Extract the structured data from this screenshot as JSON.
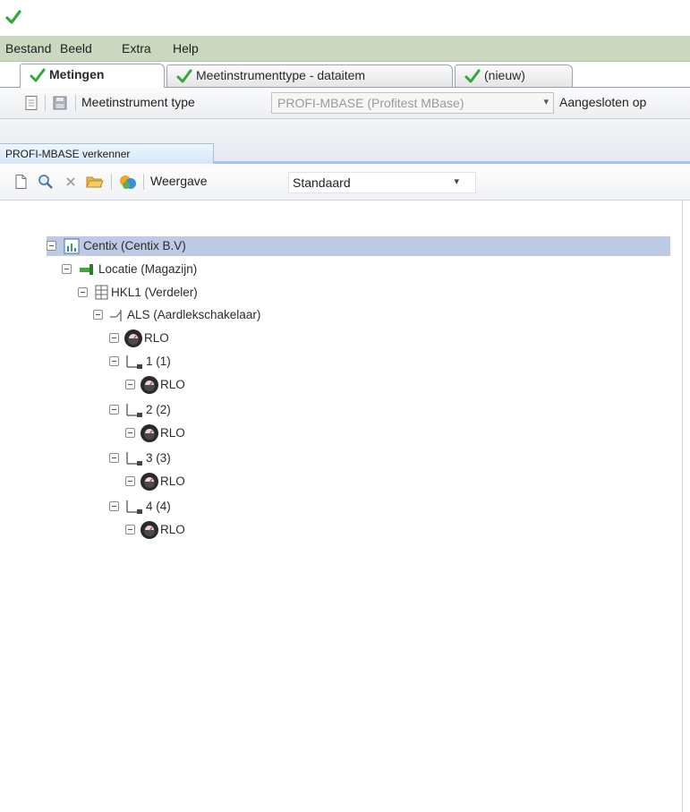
{
  "menu": {
    "items": [
      "Bestand",
      "Beeld",
      "Extra",
      "Help"
    ]
  },
  "tabs": [
    {
      "label": "Metingen",
      "active": true
    },
    {
      "label": "Meetinstrumenttype - dataitem",
      "active": false
    },
    {
      "label": "(nieuw)",
      "active": false
    }
  ],
  "toolbar1": {
    "type_label": "Meetinstrument type",
    "type_value": "PROFI-MBASE (Profitest MBase)",
    "connected_label": "Aangesloten op"
  },
  "panel": {
    "tab_label": "PROFI-MBASE verkenner"
  },
  "toolbar2": {
    "view_label": "Weergave",
    "view_value": "Standaard"
  },
  "tree": {
    "nodes": [
      {
        "text": "Centix (Centix B.V)",
        "selected": true
      },
      {
        "text": "Locatie (Magazijn)"
      },
      {
        "text": "HKL1 (Verdeler)"
      },
      {
        "text": "ALS (Aardlekschakelaar)"
      },
      {
        "text": "RLO"
      },
      {
        "text": "1 (1)"
      },
      {
        "text": "RLO"
      },
      {
        "text": "2 (2)"
      },
      {
        "text": "RLO"
      },
      {
        "text": "3 (3)"
      },
      {
        "text": "RLO"
      },
      {
        "text": "4 (4)"
      },
      {
        "text": "RLO"
      }
    ]
  },
  "colors": {
    "menubar": "#ccd7c0",
    "check_green": "#2fa83c",
    "selection": "#bccae4",
    "panel_tab": "#d4e7f8"
  },
  "icons": {
    "app": "green-check-icon",
    "company": "company-icon",
    "location": "green-flag-icon",
    "distributor": "distribution-board-icon",
    "rcd": "rcd-switch-icon",
    "group": "group-circuit-icon",
    "measurement": "rlo-meter-icon"
  }
}
